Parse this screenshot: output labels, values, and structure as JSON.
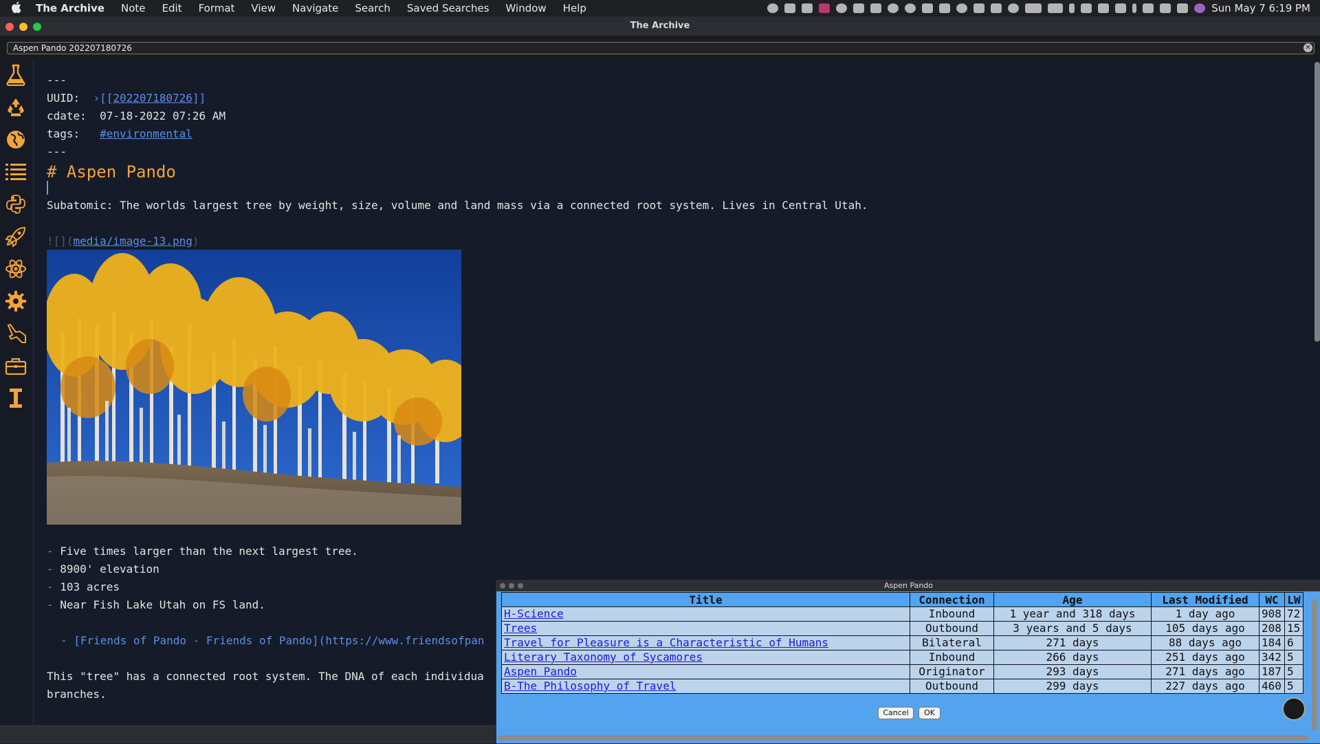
{
  "menubar": {
    "app_name": "The Archive",
    "items": [
      "Note",
      "Edit",
      "Format",
      "View",
      "Navigate",
      "Search",
      "Saved Searches",
      "Window",
      "Help"
    ],
    "clock": "Sun May 7  6:19 PM"
  },
  "window": {
    "title": "The Archive"
  },
  "omnibar": {
    "value": "Aspen Pando 202207180726"
  },
  "sidebar": {
    "icons": [
      "flask-icon",
      "recycle-icon",
      "globe-icon",
      "list-icon",
      "python-icon",
      "rocket-icon",
      "atom-icon",
      "gear-icon",
      "hand-icon",
      "briefcase-icon",
      "text-cursor-icon"
    ]
  },
  "editor": {
    "frontmatter_open": "---",
    "uuid_key": "UUID:",
    "uuid_prefix": "›[[",
    "uuid_value": "202207180726",
    "uuid_suffix": "]]",
    "cdate_key": "cdate:",
    "cdate_value": "07-18-2022 07:26 AM",
    "tags_key": "tags:",
    "tags_value": "#environmental",
    "frontmatter_close": "---",
    "heading": "# Aspen Pando",
    "subatomic": "Subatomic: The worlds largest tree by weight, size, volume and land mass via a connected root system. Lives in Central Utah.",
    "image_prefix": "![](",
    "image_link": "media/image-13.png",
    "image_suffix": ")",
    "bullets": [
      "Five times larger than the next largest tree.",
      "8900' elevation",
      "103 acres",
      "Near Fish Lake Utah on FS land."
    ],
    "bullet_marker": "-",
    "sub_link": "- [Friends of Pando - Friends of Pando](https://www.friendsofpan",
    "paragraph_line1": "This \"tree\" has a connected root system. The DNA of each individua",
    "paragraph_line2": "branches."
  },
  "popup": {
    "title": "Aspen Pando",
    "columns": [
      "Title",
      "Connection",
      "Age",
      "Last Modified",
      "WC",
      "LW"
    ],
    "rows": [
      {
        "title": "H-Science",
        "connection": "Inbound",
        "age": "1 year and 318 days",
        "modified": "1 day ago",
        "wc": "908",
        "lw": "72"
      },
      {
        "title": "Trees",
        "connection": "Outbound",
        "age": "3 years and 5 days",
        "modified": "105 days ago",
        "wc": "208",
        "lw": "15"
      },
      {
        "title": "Travel for Pleasure is a Characteristic of Humans",
        "connection": "Bilateral",
        "age": "271 days",
        "modified": "88 days ago",
        "wc": "184",
        "lw": "6"
      },
      {
        "title": "Literary Taxonomy of Sycamores",
        "connection": "Inbound",
        "age": "266 days",
        "modified": "251 days ago",
        "wc": "342",
        "lw": "5"
      },
      {
        "title": "Aspen Pando",
        "connection": "Originator",
        "age": "293 days",
        "modified": "271 days ago",
        "wc": "187",
        "lw": "5"
      },
      {
        "title": "B-The Philosophy of Travel",
        "connection": "Outbound",
        "age": "299 days",
        "modified": "227 days ago",
        "wc": "460",
        "lw": "5"
      }
    ],
    "cancel_label": "Cancel",
    "ok_label": "OK"
  },
  "colors": {
    "editor_bg": "#151b29",
    "heading": "#f2a33a",
    "link": "#5b8fe8",
    "popup_bg": "#54a3ef",
    "row_bg": "#bcd3ec"
  }
}
